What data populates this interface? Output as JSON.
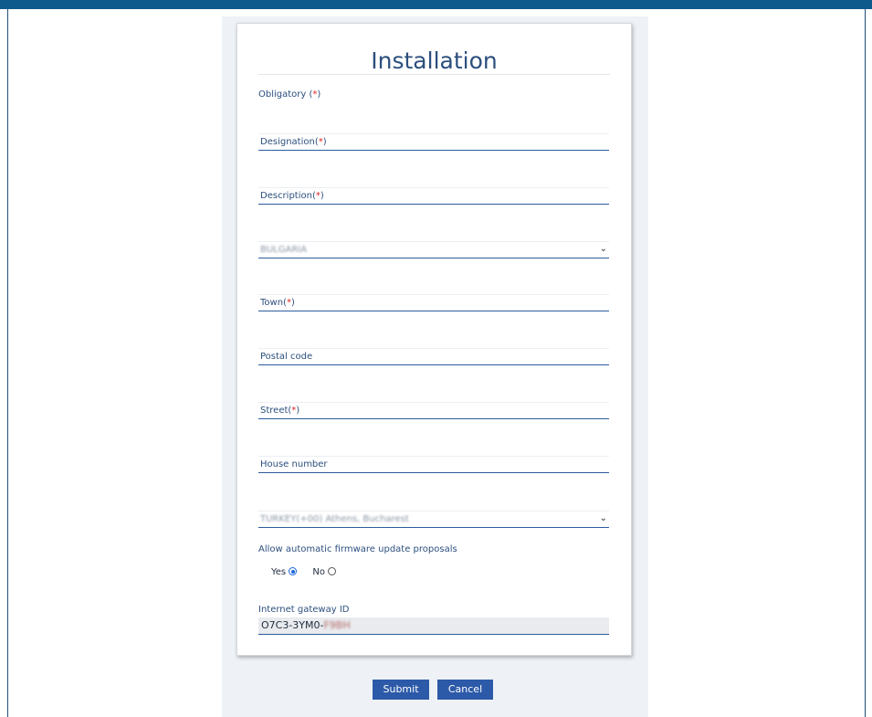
{
  "form": {
    "title": "Installation",
    "obligatory_label": "Obligatory (",
    "required_mark": "*",
    "close_paren": ")",
    "fields": {
      "designation": "Designation",
      "description": "Description",
      "country_value": "BULGARIA",
      "town": "Town",
      "postal_code": "Postal code",
      "street": "Street",
      "house_number": "House number",
      "timezone_value": "TURKEY(+00) Athens, Bucharest"
    },
    "firmware_question": "Allow automatic firmware update proposals",
    "radio_options": {
      "yes": "Yes",
      "no": "No"
    },
    "radio_selected": "yes",
    "gateway_label": "Internet gateway ID",
    "gateway_value_visible": "O7C3-3YM0-",
    "gateway_value_blurred": "F9BH"
  },
  "buttons": {
    "submit": "Submit",
    "cancel": "Cancel"
  },
  "icons": {
    "select_chevron": "chevron-down-icon"
  },
  "colors": {
    "topbar": "#0f5a8c",
    "accent": "#2c4f7e",
    "button": "#2d5aa8",
    "required": "#e02424",
    "radio_checked": "#1a66e0"
  }
}
